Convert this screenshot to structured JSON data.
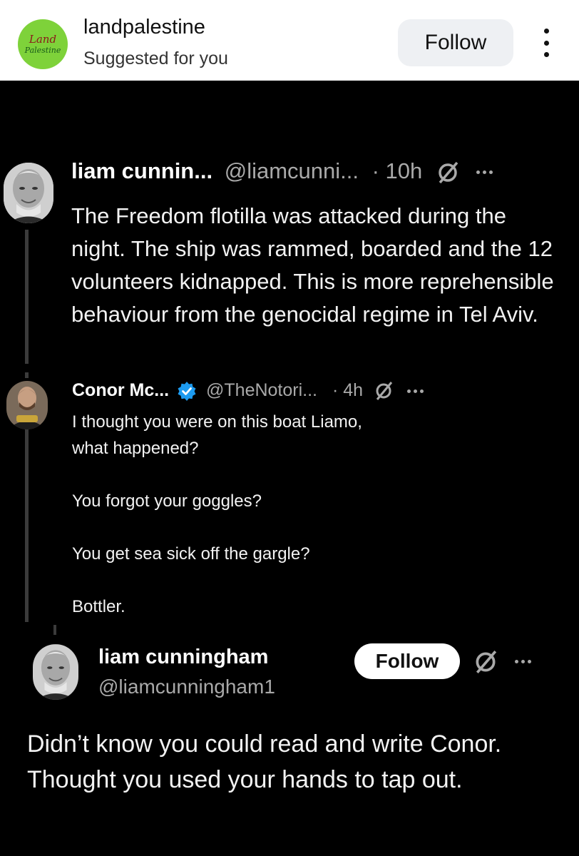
{
  "header": {
    "brand_line1": "Land",
    "brand_line2": "Palestine",
    "account_name": "landpalestine",
    "subtitle": "Suggested for you",
    "follow_label": "Follow"
  },
  "tweet1": {
    "name": "liam cunnin...",
    "handle": "@liamcunni...",
    "time": "· 10h",
    "text": "The Freedom flotilla was attacked during the night. The ship was rammed, boarded and the 12 volunteers kidnapped. This is more reprehensible behaviour from the genocidal regime in Tel Aviv."
  },
  "tweet2": {
    "name": "Conor Mc...",
    "handle": "@TheNotori...",
    "time": "· 4h",
    "line1": "I thought you were on this boat Liamo,",
    "line2": "what happened?",
    "line3": "You forgot your goggles?",
    "line4": "You get sea sick off the gargle?",
    "line5": "Bottler."
  },
  "tweet3": {
    "name": "liam cunningham",
    "handle": "@liamcunningham1",
    "follow_label": "Follow",
    "text": "Didn’t know you could read and write Conor. Thought you used your hands to tap out."
  },
  "colors": {
    "background": "#000000",
    "verified": "#1d9bf0",
    "brand_green": "#7ed23a"
  }
}
